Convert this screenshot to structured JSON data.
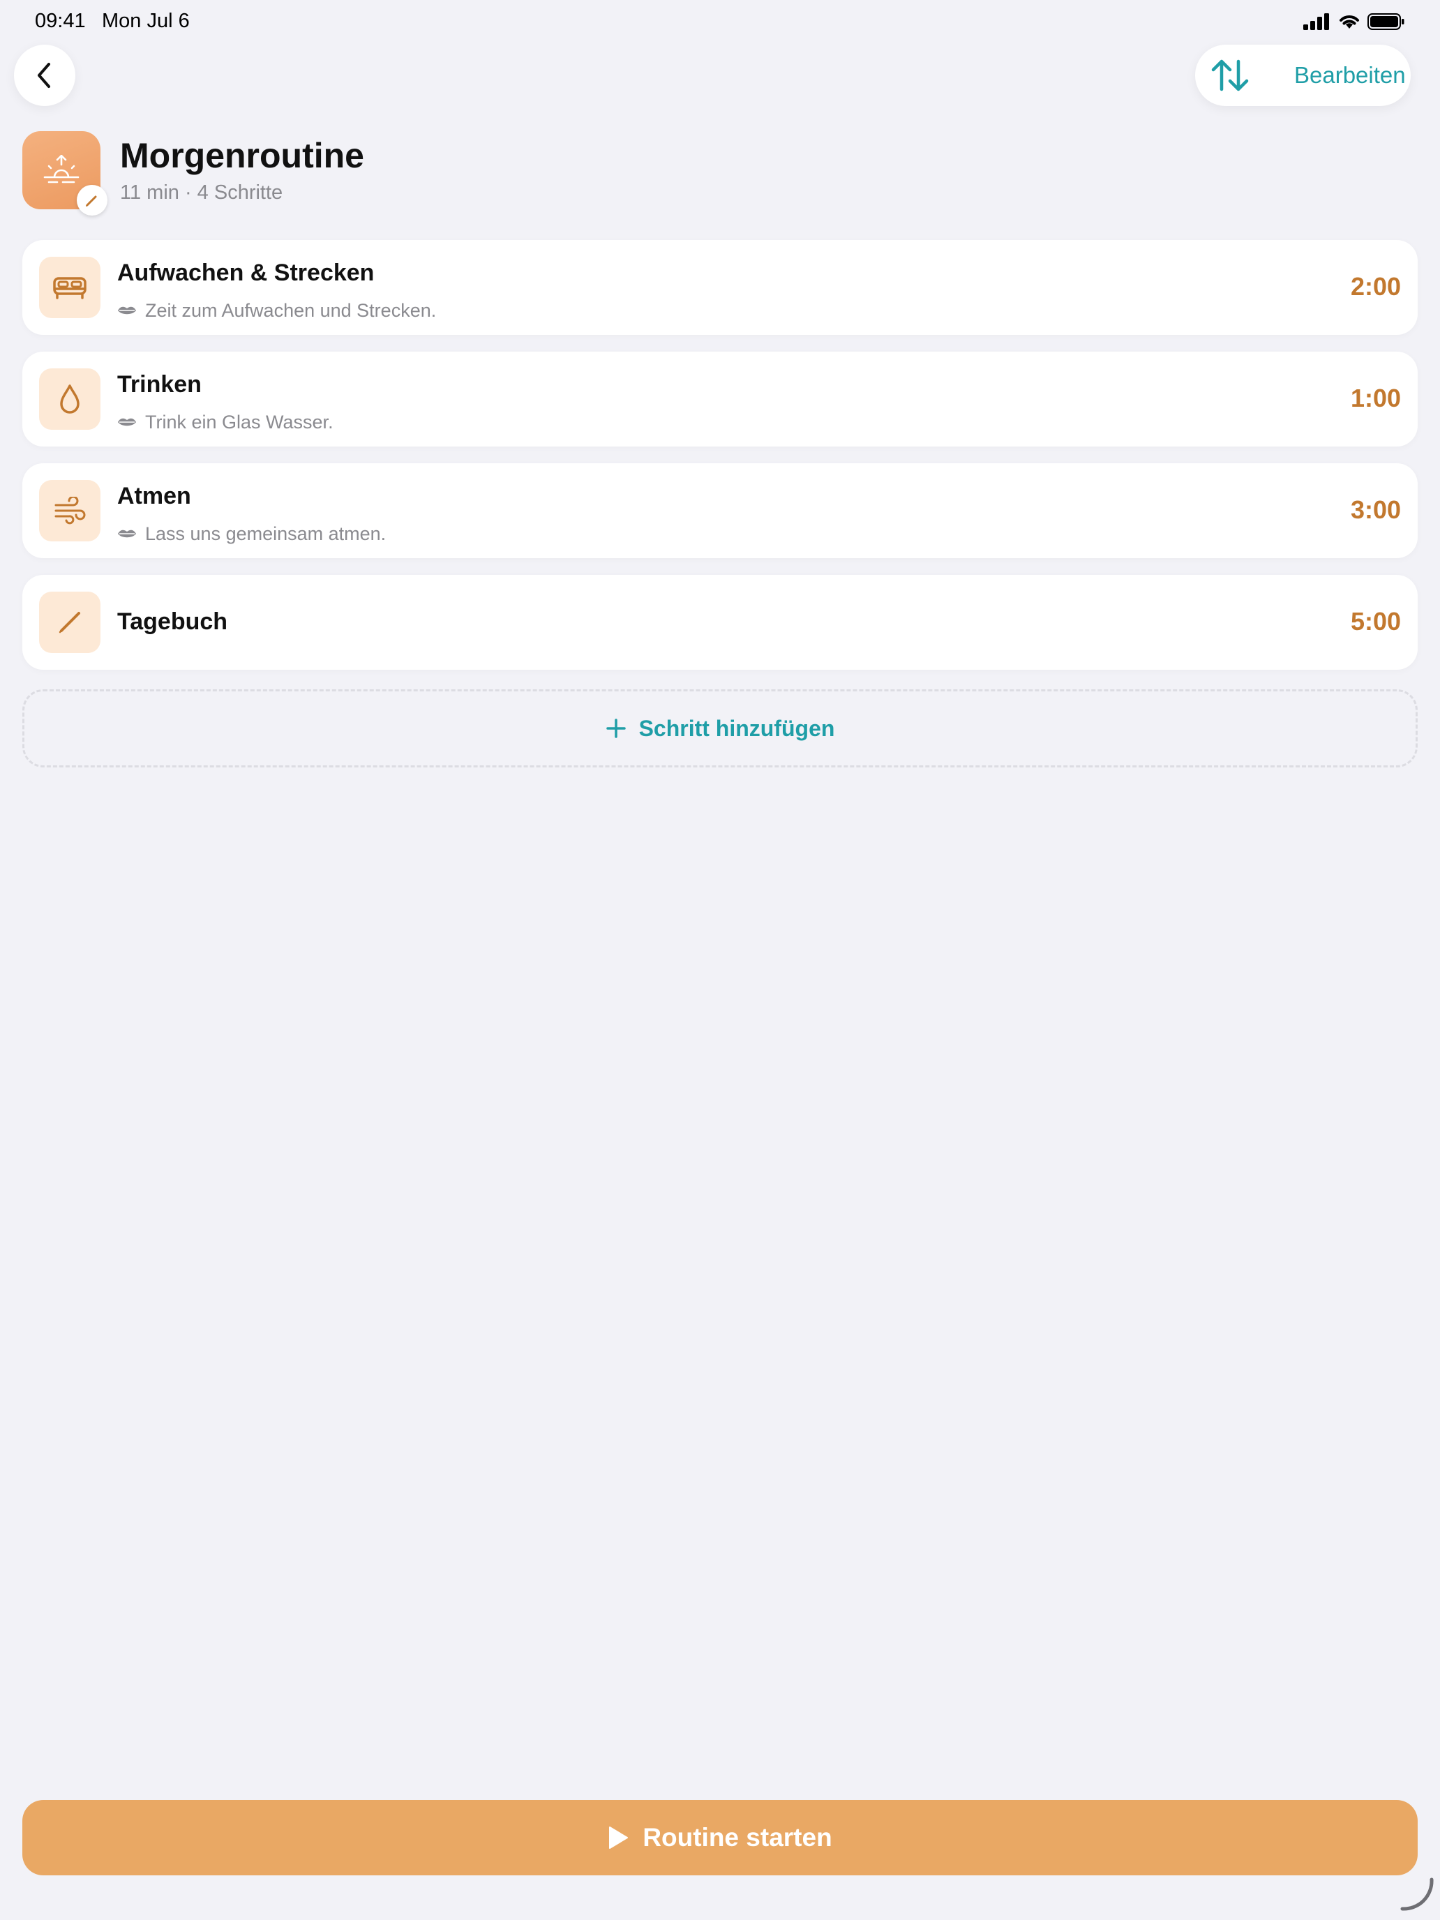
{
  "status_bar": {
    "time": "09:41",
    "date": "Mon Jul 6"
  },
  "nav": {
    "edit_label": "Bearbeiten"
  },
  "routine": {
    "title": "Morgenroutine",
    "subtitle": "11 min · 4 Schritte",
    "icon": "sunrise-icon"
  },
  "steps": [
    {
      "title": "Aufwachen & Strecken",
      "description": "Zeit zum Aufwachen und Strecken.",
      "duration": "2:00",
      "icon": "bed-icon"
    },
    {
      "title": "Trinken",
      "description": "Trink ein Glas Wasser.",
      "duration": "1:00",
      "icon": "water-drop-icon"
    },
    {
      "title": "Atmen",
      "description": "Lass uns gemeinsam atmen.",
      "duration": "3:00",
      "icon": "wind-icon"
    },
    {
      "title": "Tagebuch",
      "description": "",
      "duration": "5:00",
      "icon": "pencil-icon"
    }
  ],
  "add_step_label": "Schritt hinzufügen",
  "start_label": "Routine starten",
  "colors": {
    "accent_teal": "#1f9ea7",
    "accent_orange": "#e9a864",
    "duration_brown": "#c2782e",
    "icon_bg": "#fde9d6",
    "background": "#f2f2f7"
  }
}
